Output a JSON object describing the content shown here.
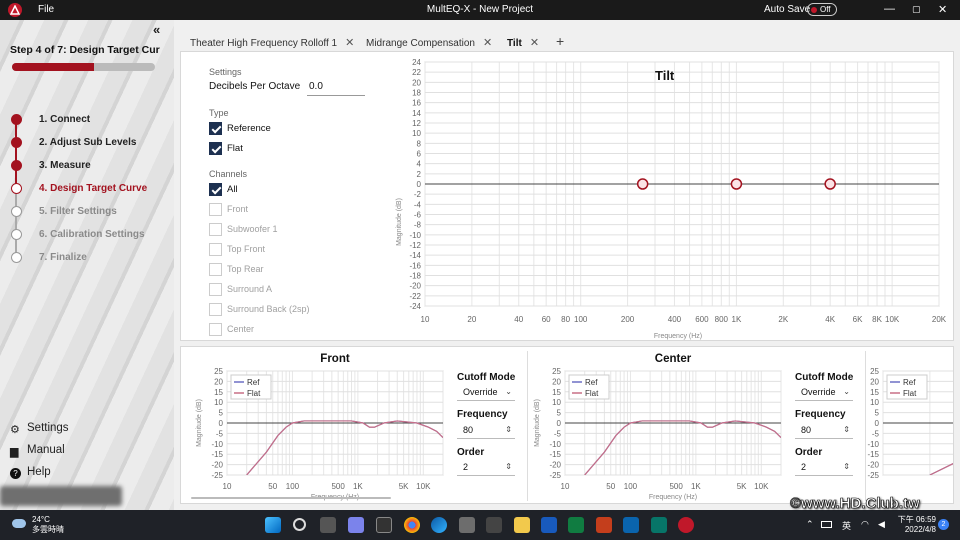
{
  "titlebar": {
    "file_menu": "File",
    "window_title": "MultEQ-X - New Project",
    "autosave_label": "Auto Save",
    "autosave_state": "Off",
    "min": "—",
    "max": "▢",
    "close": "✕"
  },
  "sidebar": {
    "collapse": "«",
    "step_title": "Step 4 of 7: Design Target Curve",
    "progress": 0.57,
    "steps": [
      {
        "label": "1. Connect",
        "state": "done"
      },
      {
        "label": "2. Adjust Sub Levels",
        "state": "done"
      },
      {
        "label": "3. Measure",
        "state": "done"
      },
      {
        "label": "4. Design Target Curve",
        "state": "current"
      },
      {
        "label": "5. Filter Settings",
        "state": "future"
      },
      {
        "label": "6. Calibration Settings",
        "state": "future"
      },
      {
        "label": "7. Finalize",
        "state": "future"
      }
    ],
    "links": [
      {
        "label": "Settings",
        "icon": "gear-icon"
      },
      {
        "label": "Manual",
        "icon": "book-icon"
      },
      {
        "label": "Help",
        "icon": "help-icon"
      }
    ]
  },
  "tabs": [
    {
      "label": "Theater High Frequency Rolloff 1",
      "close": "✕"
    },
    {
      "label": "Midrange Compensation",
      "close": "✕"
    },
    {
      "label": "Tilt",
      "close": "✕",
      "active": true
    }
  ],
  "tab_add": "+",
  "settings": {
    "section_settings": "Settings",
    "dpo_label": "Decibels Per Octave",
    "dpo_value": "0.0",
    "section_type": "Type",
    "type_options": [
      {
        "label": "Reference",
        "checked": true
      },
      {
        "label": "Flat",
        "checked": true
      }
    ],
    "section_channels": "Channels",
    "all": {
      "label": "All",
      "checked": true
    },
    "channels": [
      "Front",
      "Subwoofer 1",
      "Top Front",
      "Top Rear",
      "Surround A",
      "Surround Back (2sp)",
      "Center"
    ]
  },
  "main_chart": {
    "title": "Tilt",
    "ylabel": "Magnitude (dB)",
    "xlabel": "Frequency (Hz)",
    "ylim": [
      -24,
      24
    ],
    "yticks": [
      24,
      22,
      20,
      18,
      16,
      14,
      12,
      10,
      8,
      6,
      4,
      2,
      0,
      -2,
      -4,
      -6,
      -8,
      -10,
      -12,
      -14,
      -16,
      -18,
      -20,
      -22,
      -24
    ],
    "xticks": [
      {
        "v": 10,
        "t": "10"
      },
      {
        "v": 20,
        "t": "20"
      },
      {
        "v": 40,
        "t": "40"
      },
      {
        "v": 60,
        "t": "60"
      },
      {
        "v": 80,
        "t": "80"
      },
      {
        "v": 100,
        "t": "100"
      },
      {
        "v": 200,
        "t": "200"
      },
      {
        "v": 400,
        "t": "400"
      },
      {
        "v": 600,
        "t": "600"
      },
      {
        "v": 800,
        "t": "800"
      },
      {
        "v": 1000,
        "t": "1K"
      },
      {
        "v": 2000,
        "t": "2K"
      },
      {
        "v": 4000,
        "t": "4K"
      },
      {
        "v": 6000,
        "t": "6K"
      },
      {
        "v": 8000,
        "t": "8K"
      },
      {
        "v": 10000,
        "t": "10K"
      },
      {
        "v": 20000,
        "t": "20K"
      }
    ],
    "points": [
      {
        "x": 250,
        "y": 0
      },
      {
        "x": 1000,
        "y": 0
      },
      {
        "x": 4000,
        "y": 0
      }
    ]
  },
  "chart_data": [
    {
      "type": "scatter",
      "title": "Tilt",
      "xlabel": "Frequency (Hz)",
      "ylabel": "Magnitude (dB)",
      "xscale": "log",
      "xlim": [
        10,
        20000
      ],
      "ylim": [
        -24,
        24
      ],
      "x": [
        250,
        1000,
        4000
      ],
      "y": [
        0,
        0,
        0
      ]
    },
    {
      "type": "line",
      "title": "Front",
      "xlabel": "Frequency (Hz)",
      "ylabel": "Magnitude (dB)",
      "xscale": "log",
      "xlim": [
        10,
        20000
      ],
      "ylim": [
        -25,
        25
      ],
      "series": [
        {
          "name": "Ref",
          "x": [
            20,
            40,
            60,
            80,
            100,
            150,
            200,
            400,
            800,
            1200,
            1500,
            1800,
            2500,
            4000,
            8000,
            12000,
            16000,
            20000
          ],
          "y": [
            -25,
            -14,
            -6,
            -2,
            0,
            1,
            1,
            1,
            1,
            0,
            -2,
            -2,
            0,
            1,
            0,
            -2,
            -4,
            -7
          ]
        },
        {
          "name": "Flat",
          "x": [
            20,
            40,
            60,
            80,
            100,
            150,
            200,
            400,
            800,
            1200,
            1500,
            1800,
            2500,
            4000,
            8000,
            12000,
            16000,
            20000
          ],
          "y": [
            -25,
            -14,
            -6,
            -2,
            0,
            1,
            1,
            1,
            1,
            0,
            -2,
            -2,
            0,
            1,
            0,
            -2,
            -4,
            -7
          ]
        }
      ]
    },
    {
      "type": "line",
      "title": "Center",
      "xlabel": "Frequency (Hz)",
      "ylabel": "Magnitude (dB)",
      "xscale": "log",
      "xlim": [
        10,
        20000
      ],
      "ylim": [
        -25,
        25
      ],
      "series": [
        {
          "name": "Ref",
          "x": [
            20,
            40,
            60,
            80,
            100,
            150,
            200,
            400,
            800,
            1200,
            1500,
            1800,
            2500,
            4000,
            8000,
            12000,
            16000,
            20000
          ],
          "y": [
            -25,
            -14,
            -6,
            -2,
            0,
            1,
            1,
            1,
            1,
            0,
            -2,
            -2,
            0,
            1,
            0,
            -2,
            -4,
            -7
          ]
        },
        {
          "name": "Flat",
          "x": [
            20,
            40,
            60,
            80,
            100,
            150,
            200,
            400,
            800,
            1200,
            1500,
            1800,
            2500,
            4000,
            8000,
            12000,
            16000,
            20000
          ],
          "y": [
            -25,
            -14,
            -6,
            -2,
            0,
            1,
            1,
            1,
            1,
            0,
            -2,
            -2,
            0,
            1,
            0,
            -2,
            -4,
            -7
          ]
        }
      ]
    }
  ],
  "small_charts": [
    {
      "title": "Front",
      "ylabel": "Magnitude (dB)",
      "xlabel": "Frequency (Hz)",
      "legend": [
        "Ref",
        "Flat"
      ],
      "cutoff_label": "Cutoff Mode",
      "cutoff_value": "Override",
      "freq_label": "Frequency",
      "freq_value": "80",
      "order_label": "Order",
      "order_value": "2"
    },
    {
      "title": "Center",
      "ylabel": "Magnitude (dB)",
      "xlabel": "Frequency (Hz)",
      "legend": [
        "Ref",
        "Flat"
      ],
      "cutoff_label": "Cutoff Mode",
      "cutoff_value": "Override",
      "freq_label": "Frequency",
      "freq_value": "80",
      "order_label": "Order",
      "order_value": "2"
    },
    {
      "legend": [
        "Ref",
        "Flat"
      ]
    }
  ],
  "small_axis": {
    "yticks": [
      25,
      20,
      15,
      10,
      5,
      0,
      -5,
      -10,
      -15,
      -20,
      -25
    ],
    "xticks": [
      {
        "v": 10,
        "t": "10"
      },
      {
        "v": 50,
        "t": "50"
      },
      {
        "v": 100,
        "t": "100"
      },
      {
        "v": 500,
        "t": "500"
      },
      {
        "v": 1000,
        "t": "1K"
      },
      {
        "v": 5000,
        "t": "5K"
      },
      {
        "v": 10000,
        "t": "10K"
      }
    ]
  },
  "taskbar": {
    "temp": "24°C",
    "weather": "多雲時晴",
    "ime": "英",
    "time": "下午 06:59",
    "date": "2022/4/8",
    "notif": "2"
  },
  "watermark": "©www.HD.Club.tw",
  "colors": {
    "accent": "#a3121f",
    "ref": "#6c6fc4",
    "flat": "#c86f86"
  }
}
